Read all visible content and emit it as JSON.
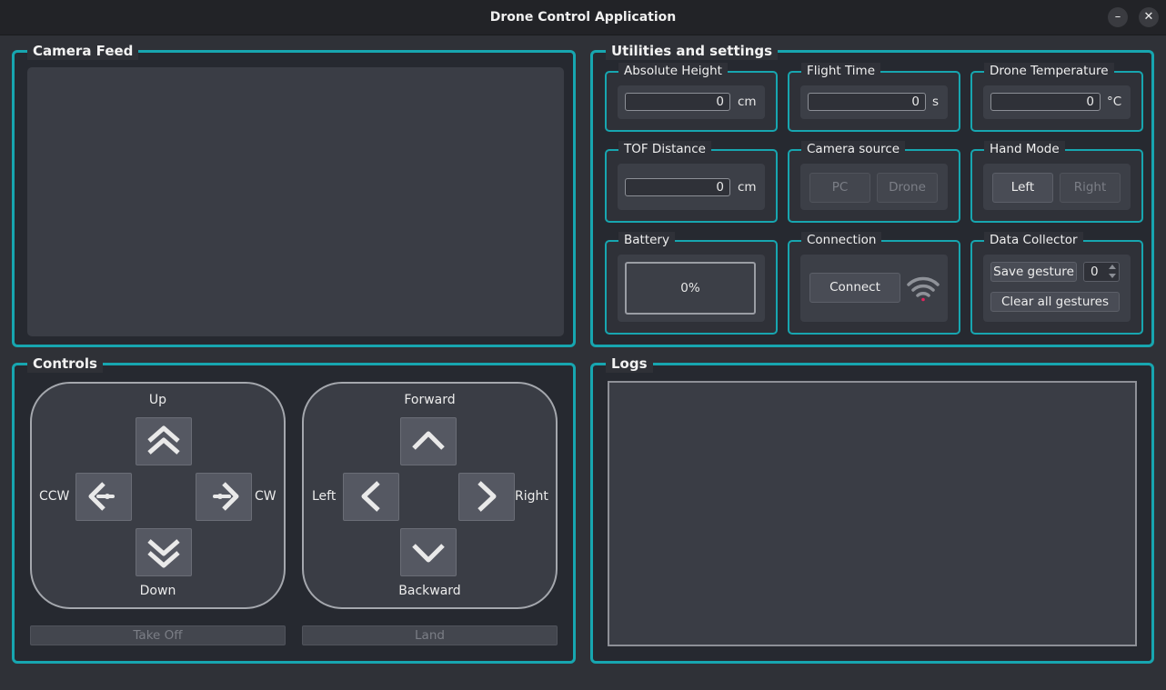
{
  "window": {
    "title": "Drone Control Application",
    "minimize": "–",
    "close": "✕"
  },
  "camera_feed": {
    "title": "Camera Feed"
  },
  "utilities": {
    "title": "Utilities and settings",
    "absolute_height": {
      "title": "Absolute Height",
      "value": "0",
      "unit": "cm"
    },
    "flight_time": {
      "title": "Flight Time",
      "value": "0",
      "unit": "s"
    },
    "drone_temperature": {
      "title": "Drone Temperature",
      "value": "0",
      "unit": "°C"
    },
    "tof_distance": {
      "title": "TOF Distance",
      "value": "0",
      "unit": "cm"
    },
    "camera_source": {
      "title": "Camera source",
      "pc": "PC",
      "drone": "Drone"
    },
    "hand_mode": {
      "title": "Hand Mode",
      "left": "Left",
      "right": "Right"
    },
    "battery": {
      "title": "Battery",
      "value": "0%"
    },
    "connection": {
      "title": "Connection",
      "connect": "Connect",
      "status_icon": "wifi-disconnected-icon"
    },
    "data_collector": {
      "title": "Data Collector",
      "save": "Save gesture",
      "count": "0",
      "clear": "Clear all gestures"
    }
  },
  "controls": {
    "title": "Controls",
    "left_pad": {
      "up": "Up",
      "down": "Down",
      "ccw": "CCW",
      "cw": "CW"
    },
    "right_pad": {
      "forward": "Forward",
      "backward": "Backward",
      "left": "Left",
      "right": "Right"
    },
    "take_off": "Take Off",
    "land": "Land"
  },
  "logs": {
    "title": "Logs"
  },
  "colors": {
    "accent": "#17a6b0",
    "background": "#2f3137",
    "panel": "#262930",
    "wifi_off": "#e0245e"
  }
}
